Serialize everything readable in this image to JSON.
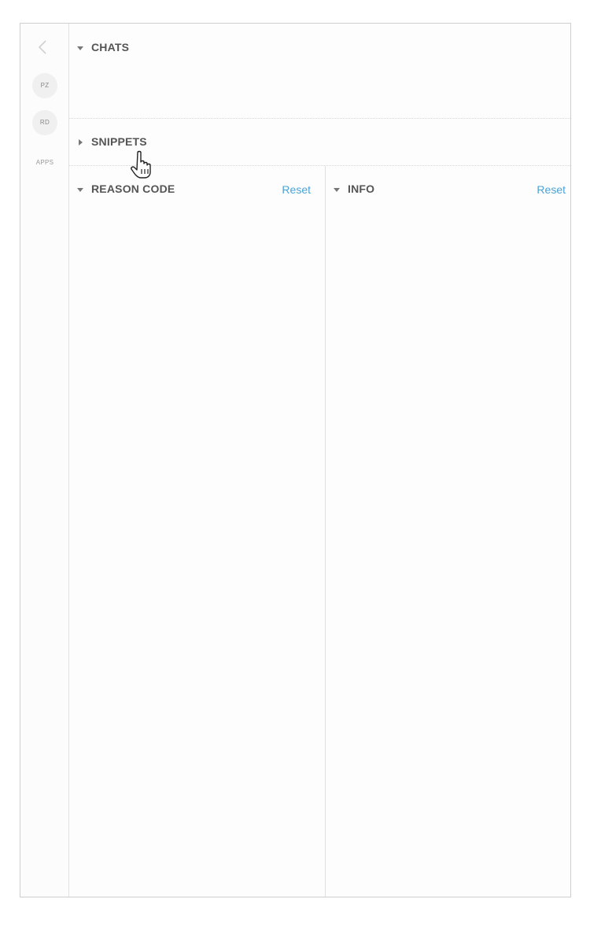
{
  "rail": {
    "back_icon": "chevron-left-icon",
    "chips": [
      "PZ",
      "RD"
    ],
    "apps_label": "APPS"
  },
  "sections": {
    "chats": {
      "label": "CHATS",
      "expanded": true
    },
    "snippets": {
      "label": "SNIPPETS",
      "expanded": false
    }
  },
  "panels": {
    "reason_code": {
      "label": "REASON CODE",
      "reset_label": "Reset"
    },
    "info": {
      "label": "INFO",
      "reset_label": "Reset"
    }
  },
  "colors": {
    "link": "#4aa3d6",
    "text": "#555555",
    "border": "#cfcfcf"
  }
}
